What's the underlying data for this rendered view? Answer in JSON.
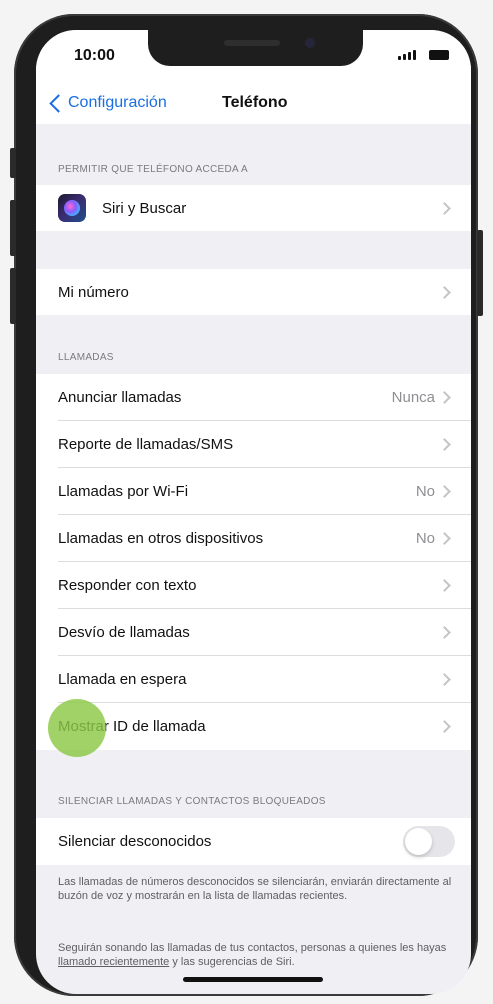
{
  "status_bar": {
    "time": "10:00"
  },
  "nav": {
    "back_label": "Configuración",
    "title": "Teléfono"
  },
  "sections": {
    "allow_header": "PERMITIR QUE TELÉFONO ACCEDA A",
    "calls_header": "LLAMADAS",
    "silence_header": "SILENCIAR LLAMADAS Y CONTACTOS BLOQUEADOS"
  },
  "rows": {
    "siri": {
      "label": "Siri y Buscar"
    },
    "my_number": {
      "label": "Mi número"
    },
    "announce_calls": {
      "label": "Anunciar llamadas",
      "value": "Nunca"
    },
    "call_sms_report": {
      "label": "Reporte de llamadas/SMS"
    },
    "wifi_calling": {
      "label": "Llamadas por Wi-Fi",
      "value": "No"
    },
    "other_devices": {
      "label": "Llamadas en otros dispositivos",
      "value": "No"
    },
    "respond_text": {
      "label": "Responder con texto"
    },
    "call_forwarding": {
      "label": "Desvío de llamadas"
    },
    "call_waiting": {
      "label": "Llamada en espera"
    },
    "show_caller_id": {
      "label": "Mostrar ID de llamada"
    },
    "silence_unknown": {
      "label": "Silenciar desconocidos",
      "enabled": false
    }
  },
  "footnotes": {
    "first": "Las llamadas de números desconocidos se silenciarán, enviarán directamente al buzón de voz y mostrarán en la lista de llamadas recientes.",
    "second_before": "Seguirán sonando las llamadas de tus contactos, personas a quienes les hayas ",
    "second_link": "llamado recientemente",
    "second_after": " y las sugerencias de Siri."
  },
  "colors": {
    "accent": "#1a6fe0",
    "group_background": "#efeff4",
    "touch_indicator": "#8cc846"
  },
  "icons": {
    "back": "chevron-left-icon",
    "siri": "siri-icon",
    "disclosure": "chevron-right-icon"
  }
}
